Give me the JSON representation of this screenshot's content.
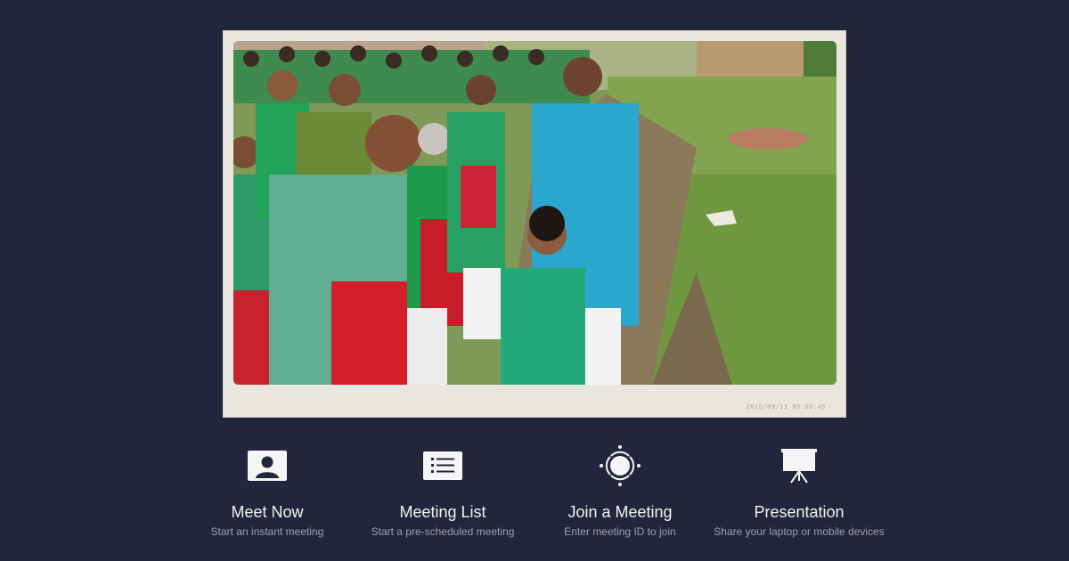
{
  "hero": {
    "photo_description_icon": "photo-icon",
    "stamp": "2015/09/11 05:05:46"
  },
  "actions": [
    {
      "title": "Meet Now",
      "subtitle": "Start an instant meeting",
      "icon": "person-icon"
    },
    {
      "title": "Meeting List",
      "subtitle": "Start a pre-scheduled meeting",
      "icon": "list-icon"
    },
    {
      "title": "Join a Meeting",
      "subtitle": "Enter meeting ID to join",
      "icon": "join-icon"
    },
    {
      "title": "Presentation",
      "subtitle": "Share your laptop or mobile devices",
      "icon": "projector-icon"
    }
  ],
  "colors": {
    "background": "#23253a",
    "text_primary": "#f2f2f5",
    "text_secondary": "#9c9eb0"
  }
}
